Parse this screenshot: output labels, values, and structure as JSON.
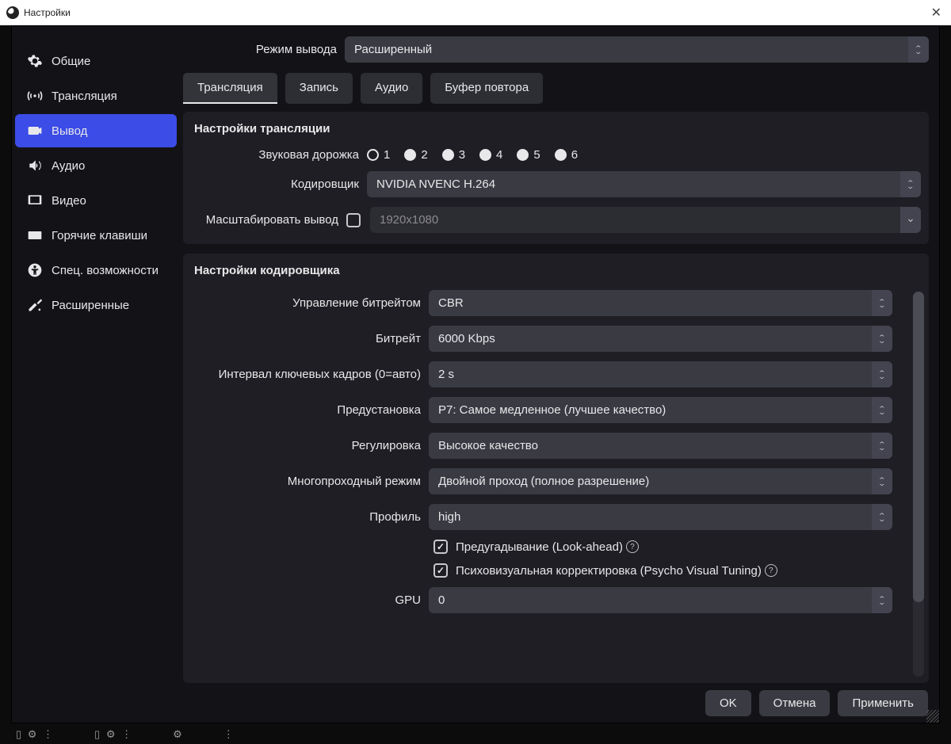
{
  "titlebar": {
    "title": "Настройки"
  },
  "sidebar": {
    "items": [
      {
        "label": "Общие"
      },
      {
        "label": "Трансляция"
      },
      {
        "label": "Вывод"
      },
      {
        "label": "Аудио"
      },
      {
        "label": "Видео"
      },
      {
        "label": "Горячие клавиши"
      },
      {
        "label": "Спец. возможности"
      },
      {
        "label": "Расширенные"
      }
    ]
  },
  "output_mode": {
    "label": "Режим вывода",
    "value": "Расширенный"
  },
  "tabs": [
    {
      "label": "Трансляция"
    },
    {
      "label": "Запись"
    },
    {
      "label": "Аудио"
    },
    {
      "label": "Буфер повтора"
    }
  ],
  "stream_section": {
    "title": "Настройки трансляции",
    "audio_track_label": "Звуковая дорожка",
    "audio_tracks": [
      "1",
      "2",
      "3",
      "4",
      "5",
      "6"
    ],
    "audio_track_selected": "1",
    "encoder_label": "Кодировщик",
    "encoder_value": "NVIDIA NVENC H.264",
    "rescale_label": "Масштабировать вывод",
    "rescale_value": "1920x1080"
  },
  "encoder_section": {
    "title": "Настройки кодировщика",
    "rate_control_label": "Управление битрейтом",
    "rate_control_value": "CBR",
    "bitrate_label": "Битрейт",
    "bitrate_value": "6000 Kbps",
    "keyint_label": "Интервал ключевых кадров (0=авто)",
    "keyint_value": "2 s",
    "preset_label": "Предустановка",
    "preset_value": "P7: Самое медленное (лучшее качество)",
    "tuning_label": "Регулировка",
    "tuning_value": "Высокое качество",
    "multipass_label": "Многопроходный режим",
    "multipass_value": "Двойной проход (полное разрешение)",
    "profile_label": "Профиль",
    "profile_value": "high",
    "lookahead_label": "Предугадывание (Look-ahead)",
    "psyvis_label": "Психовизуальная корректировка (Psycho Visual Tuning)",
    "gpu_label": "GPU",
    "gpu_value": "0"
  },
  "footer": {
    "ok": "OK",
    "cancel": "Отмена",
    "apply": "Применить"
  }
}
